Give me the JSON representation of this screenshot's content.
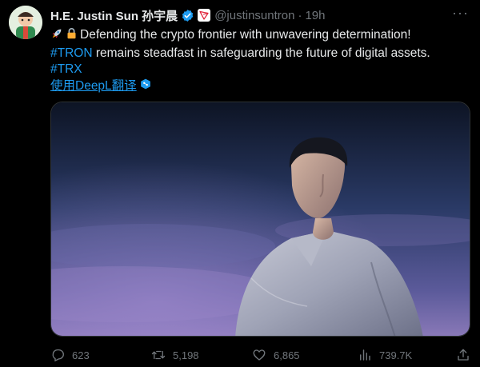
{
  "tweet": {
    "display_name": "H.E. Justin Sun 孙宇晨",
    "handle": "@justinsuntron",
    "separator": "·",
    "time": "19h",
    "more_label": "···",
    "text_line1": "Defending the crypto frontier with unwavering determination!",
    "hashtag_tron": "#TRON",
    "text_line2_rest": " remains steadfast in safeguarding the future of digital assets.",
    "hashtag_trx": "#TRX",
    "translate_label": "使用DeepL翻译",
    "emoji_icons": [
      "rocket-icon",
      "lock-icon"
    ],
    "affiliate_badge": "tron-logo",
    "verified_color": "#1d9bf0",
    "accent_color": "#1d9bf0"
  },
  "actions": {
    "replies": "623",
    "retweets": "5,198",
    "likes": "6,865",
    "views": "739.7K"
  }
}
